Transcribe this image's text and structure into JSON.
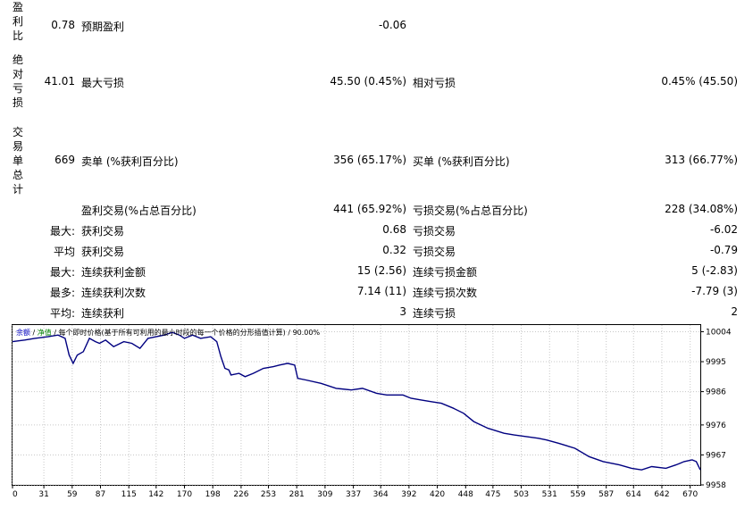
{
  "stats": {
    "profit_factor": {
      "side_label": "盈利比",
      "value": "0.78",
      "label": "预期盈利",
      "val": "-0.06"
    },
    "drawdown": {
      "side_label": "绝对亏损",
      "value": "41.01",
      "label": "最大亏损",
      "val": "45.50 (0.45%)",
      "label2": "相对亏损",
      "val2": "0.45% (45.50)"
    },
    "trades": {
      "side_label": "交易单总计",
      "value": "669",
      "label": "卖单 (%获利百分比)",
      "val": "356 (65.17%)",
      "label2": "买单 (%获利百分比)",
      "val2": "313 (66.77%)"
    },
    "profit_trades": {
      "label": "盈利交易(%占总百分比)",
      "val": "441 (65.92%)",
      "label2": "亏损交易(%占总百分比)",
      "val2": "228 (34.08%)"
    },
    "largest": {
      "prefix": "最大:",
      "label": "获利交易",
      "val": "0.68",
      "label2": "亏损交易",
      "val2": "-6.02"
    },
    "average": {
      "prefix": "平均",
      "label": "获利交易",
      "val": "0.32",
      "label2": "亏损交易",
      "val2": "-0.79"
    },
    "max_consec": {
      "prefix": "最大:",
      "label": "连续获利金额",
      "val": "15 (2.56)",
      "label2": "连续亏损金额",
      "val2": "5 (-2.83)"
    },
    "max_consec_count": {
      "prefix": "最多:",
      "label": "连续获利次数",
      "val": "7.14 (11)",
      "label2": "连续亏损次数",
      "val2": "-7.79 (3)"
    },
    "avg_consec": {
      "prefix": "平均:",
      "label": "连续获利",
      "val": "3",
      "label2": "连续亏损",
      "val2": "2"
    }
  },
  "chart_header": {
    "balance": "余额",
    "sep1": " / ",
    "equity": "净值",
    "rest": " / 每个即时价格(基于所有可利用的最小时段的每一个价格的分形插值计算) / 90.00%",
    "balance_color": "#0000c0",
    "equity_color": "#008000"
  },
  "chart_data": {
    "type": "line",
    "x_ticks": [
      0,
      31,
      59,
      87,
      115,
      142,
      170,
      198,
      226,
      253,
      281,
      309,
      337,
      364,
      392,
      420,
      448,
      475,
      503,
      531,
      559,
      587,
      614,
      642,
      670
    ],
    "y_ticks": [
      10004,
      9995,
      9986,
      9976,
      9967,
      9958
    ],
    "ylim": [
      9958,
      10006
    ],
    "xlim": [
      0,
      680
    ],
    "grid": true,
    "line_color": "#000080",
    "series": [
      {
        "points": [
          [
            0,
            10001
          ],
          [
            12,
            10001.5
          ],
          [
            22,
            10002
          ],
          [
            35,
            10002.5
          ],
          [
            45,
            10003
          ],
          [
            52,
            10002
          ],
          [
            56,
            9997
          ],
          [
            60,
            9994.5
          ],
          [
            64,
            9997
          ],
          [
            70,
            9998
          ],
          [
            76,
            10002
          ],
          [
            82,
            10001
          ],
          [
            86,
            10000.5
          ],
          [
            92,
            10001.5
          ],
          [
            100,
            9999.5
          ],
          [
            110,
            10001
          ],
          [
            118,
            10000.5
          ],
          [
            126,
            9999
          ],
          [
            134,
            10002
          ],
          [
            142,
            10002.5
          ],
          [
            150,
            10003
          ],
          [
            158,
            10003.8
          ],
          [
            165,
            10003
          ],
          [
            170,
            10002
          ],
          [
            178,
            10003
          ],
          [
            186,
            10002
          ],
          [
            196,
            10002.5
          ],
          [
            202,
            10001
          ],
          [
            206,
            9996.5
          ],
          [
            210,
            9993
          ],
          [
            214,
            9992.5
          ],
          [
            216,
            9991
          ],
          [
            224,
            9991.5
          ],
          [
            230,
            9990.5
          ],
          [
            238,
            9991.5
          ],
          [
            248,
            9993
          ],
          [
            258,
            9993.5
          ],
          [
            264,
            9994
          ],
          [
            272,
            9994.5
          ],
          [
            279,
            9994
          ],
          [
            282,
            9990
          ],
          [
            290,
            9989.5
          ],
          [
            305,
            9988.5
          ],
          [
            320,
            9987
          ],
          [
            335,
            9986.5
          ],
          [
            346,
            9987
          ],
          [
            360,
            9985.5
          ],
          [
            370,
            9985
          ],
          [
            386,
            9985
          ],
          [
            394,
            9984
          ],
          [
            404,
            9983.5
          ],
          [
            414,
            9983
          ],
          [
            424,
            9982.5
          ],
          [
            436,
            9981
          ],
          [
            446,
            9979.5
          ],
          [
            456,
            9977
          ],
          [
            470,
            9975
          ],
          [
            486,
            9973.5
          ],
          [
            496,
            9973
          ],
          [
            508,
            9972.5
          ],
          [
            520,
            9972
          ],
          [
            528,
            9971.5
          ],
          [
            540,
            9970.5
          ],
          [
            556,
            9969
          ],
          [
            570,
            9966.5
          ],
          [
            584,
            9965
          ],
          [
            600,
            9964
          ],
          [
            612,
            9963
          ],
          [
            622,
            9962.5
          ],
          [
            632,
            9963.5
          ],
          [
            646,
            9963
          ],
          [
            656,
            9964
          ],
          [
            664,
            9965
          ],
          [
            672,
            9965.5
          ],
          [
            676,
            9965
          ],
          [
            680,
            9962.5
          ]
        ]
      }
    ]
  }
}
